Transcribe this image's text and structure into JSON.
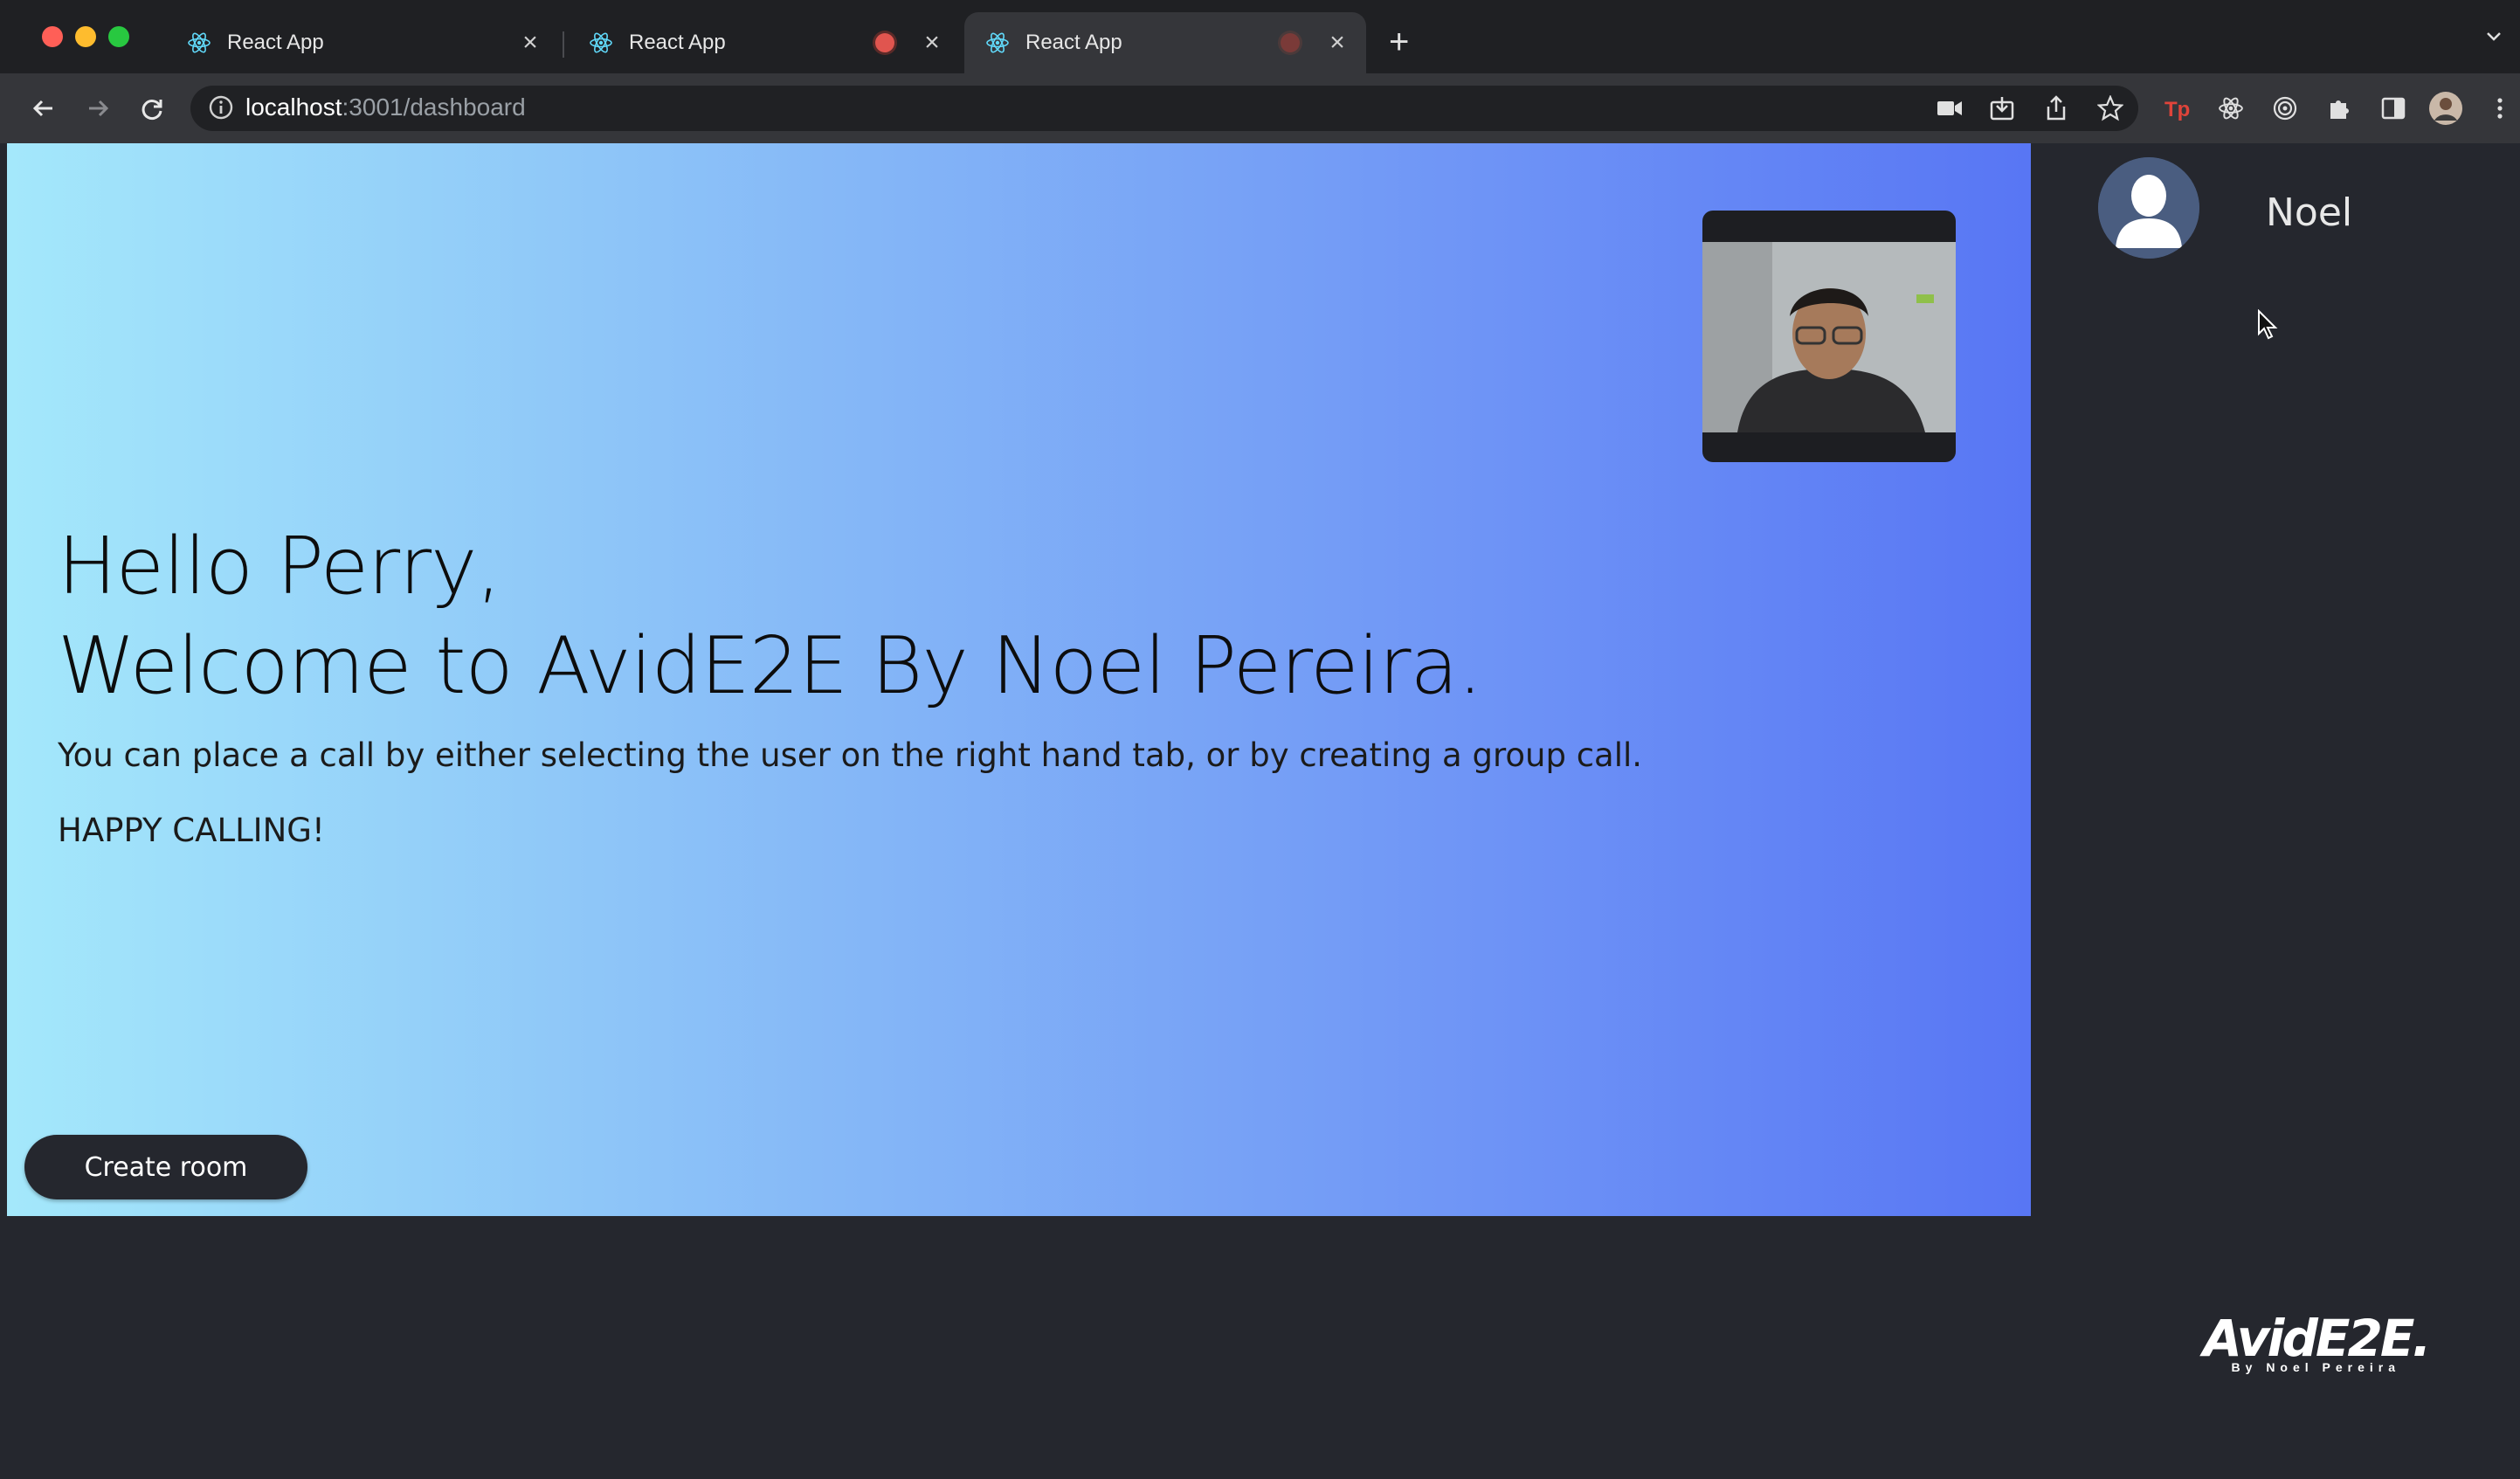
{
  "browser": {
    "tabs": [
      {
        "title": "React App",
        "active": false,
        "recording": false
      },
      {
        "title": "React App",
        "active": false,
        "recording": true
      },
      {
        "title": "React App",
        "active": true,
        "recording": true
      }
    ],
    "url_host": "localhost",
    "url_path": ":3001/dashboard",
    "close_glyph": "×",
    "new_tab_glyph": "+"
  },
  "hero": {
    "greeting_line1": "Hello Perry,",
    "greeting_line2": "Welcome to AvidE2E By Noel Pereira.",
    "description": "You can place a call by either selecting the user on the right hand tab, or by creating a group call.",
    "tagline": "HAPPY CALLING!",
    "create_room_label": "Create room"
  },
  "sidebar": {
    "users": [
      {
        "name": "Noel"
      }
    ]
  },
  "logo": {
    "main": "AvidE2E.",
    "sub": "By Noel Pereira"
  },
  "colors": {
    "gradient_start": "#a4e8fb",
    "gradient_end": "#5876f4",
    "page_bg": "#25272e",
    "recording_red": "#e0554f"
  }
}
